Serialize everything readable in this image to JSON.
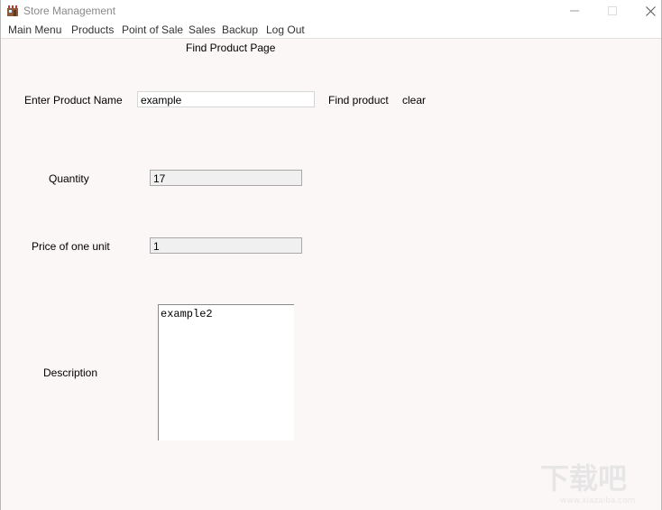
{
  "window": {
    "title": "Store Management",
    "accent": "#8a8a8a"
  },
  "menu": {
    "items": [
      "Main Menu",
      "Products",
      "Point of Sale",
      "Sales",
      "Backup",
      "Log Out"
    ]
  },
  "page": {
    "title": "Find Product Page"
  },
  "search": {
    "label": "Enter Product Name",
    "value": "example",
    "find_button": "Find product",
    "clear_button": "clear"
  },
  "quantity": {
    "label": "Quantity",
    "value": "17"
  },
  "price": {
    "label": "Price of one unit",
    "value": "1"
  },
  "description": {
    "label": "Description",
    "value": "example2"
  },
  "icons": {
    "app": "store-icon",
    "minimize": "minimize-icon",
    "maximize": "maximize-icon",
    "close": "close-icon"
  },
  "watermark": {
    "text": "下载吧",
    "subtext": "www.xiazaiba.com"
  }
}
